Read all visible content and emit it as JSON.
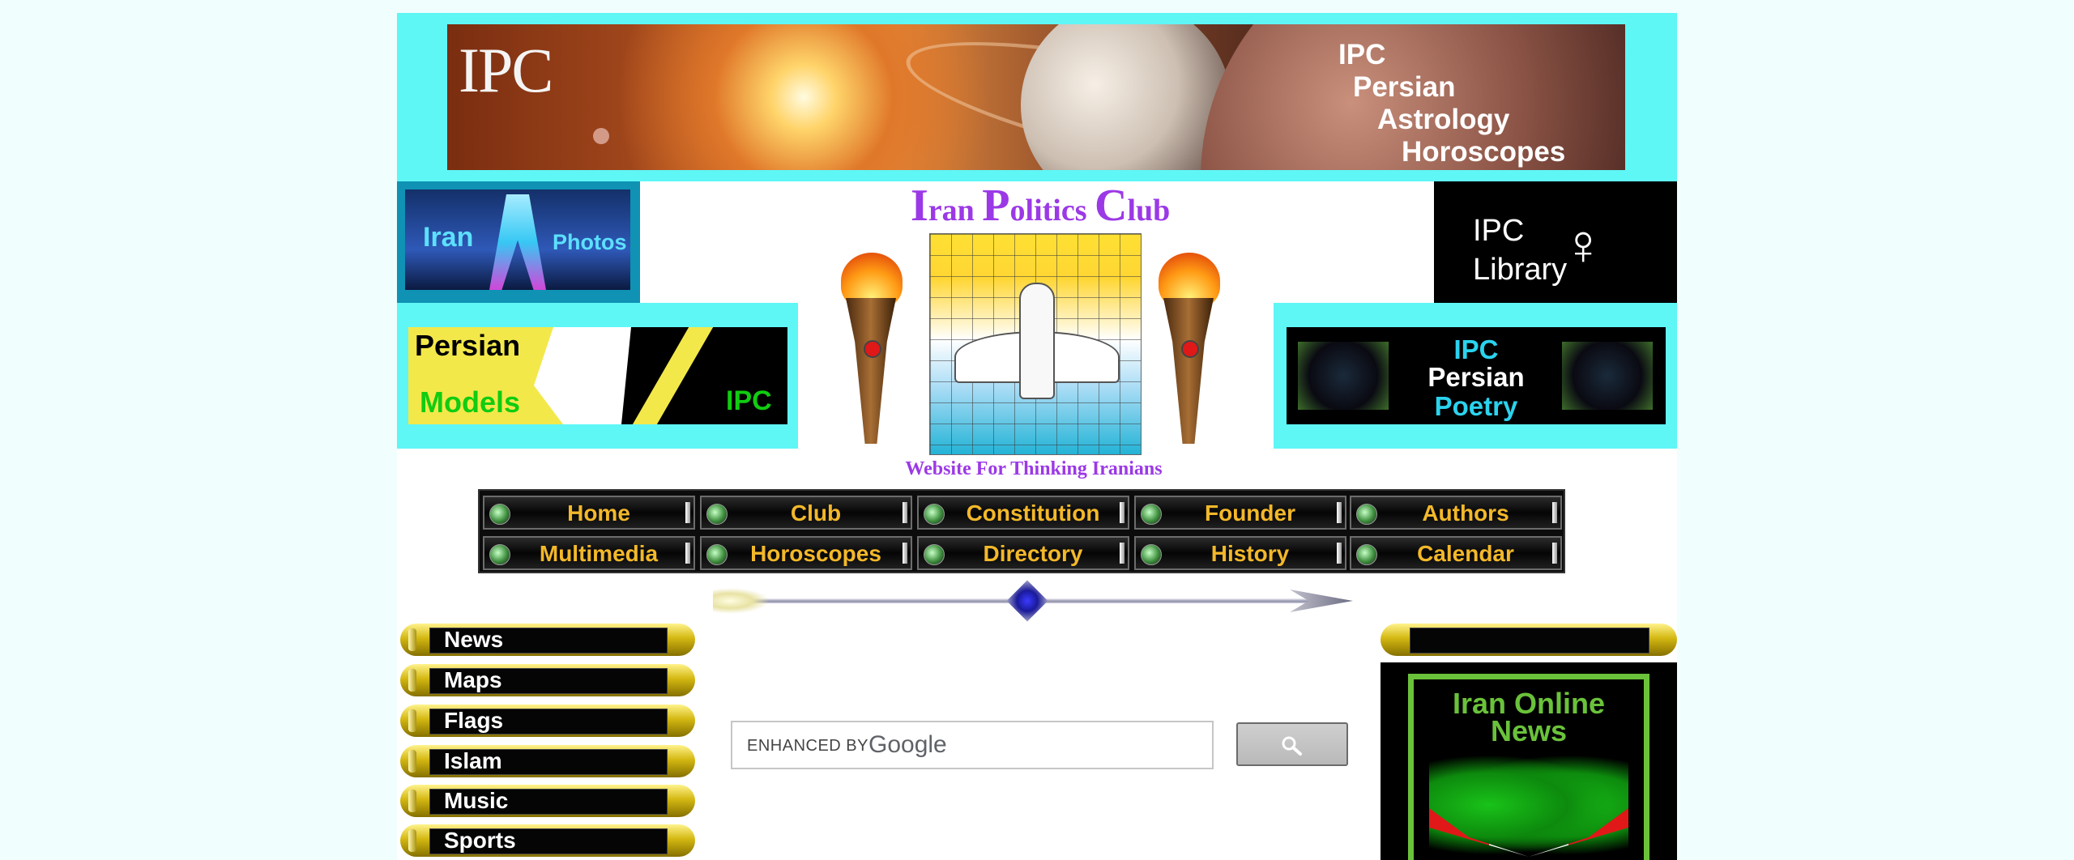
{
  "banner": {
    "logo": "IPC",
    "lines": [
      "IPC",
      "Persian",
      "Astrology",
      "Horoscopes"
    ]
  },
  "tiles": {
    "photos": {
      "word1": "Iran",
      "word2": "Photos"
    },
    "library": {
      "line1": "IPC",
      "line2": "Library"
    },
    "models": {
      "line1": "Persian",
      "line2": "Models",
      "tag": "IPC"
    },
    "poetry": {
      "line1": "IPC",
      "line2": "Persian",
      "line3": "Poetry"
    }
  },
  "site": {
    "title_I": "I",
    "title_ran": "ran ",
    "title_P": "P",
    "title_olitics": "olitics ",
    "title_C": "C",
    "title_lub": "lub",
    "tagline": "Website For Thinking Iranians"
  },
  "nav": {
    "row1": [
      "Home",
      "Club",
      "Constitution",
      "Founder",
      "Authors"
    ],
    "row2": [
      "Multimedia",
      "Horoscopes",
      "Directory",
      "History",
      "Calendar"
    ]
  },
  "left_menu": [
    "News",
    "Maps",
    "Flags",
    "Islam",
    "Music",
    "Sports"
  ],
  "right_tile": {
    "title_line1": "Iran Online",
    "title_line2": "News"
  },
  "search": {
    "enhanced_by": "ENHANCED BY",
    "brand": "Google",
    "placeholder": ""
  },
  "colors": {
    "cyan_band": "#5ff6f6",
    "title_purple": "#9b39e6",
    "nav_text": "#f3b82a",
    "page_bg": "#f0fefe"
  }
}
